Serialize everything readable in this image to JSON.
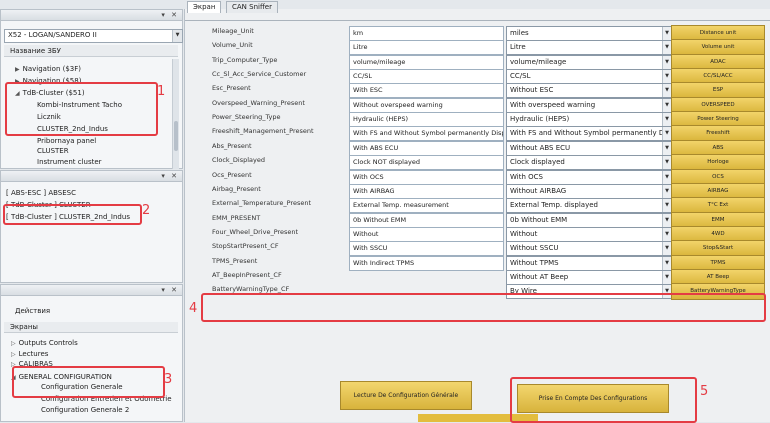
{
  "left_top": {
    "ecu_select": "X52 - LOGAN/SANDERO II",
    "list_header": "Название ЗБУ",
    "tree": [
      {
        "label": "Navigation ($3F)",
        "level": 0,
        "arrow": "▶"
      },
      {
        "label": "Navigation ($58)",
        "level": 0,
        "arrow": "▶"
      },
      {
        "label": "TdB-Cluster ($51)",
        "level": 0,
        "arrow": "◢"
      },
      {
        "label": "Kombi-Instrument Tacho",
        "level": 1,
        "arrow": ""
      },
      {
        "label": "Licznik",
        "level": 1,
        "arrow": ""
      },
      {
        "label": "CLUSTER_2nd_Indus",
        "level": 1,
        "arrow": ""
      },
      {
        "label": "Pribornaya panel",
        "level": 1,
        "arrow": ""
      },
      {
        "label": "CLUSTER",
        "level": 1,
        "arrow": ""
      },
      {
        "label": "Instrument cluster",
        "level": 1,
        "arrow": ""
      }
    ]
  },
  "left_mid": {
    "items": [
      "[ ABS-ESC ] ABSESC",
      "[ TdB-Cluster ] CLUSTER",
      "[ TdB-Cluster ] CLUSTER_2nd_Indus"
    ]
  },
  "left_bottom": {
    "title": "Действия",
    "header": "Экраны",
    "items": [
      {
        "label": "Outputs Controls",
        "level": 0,
        "arrow": "▷"
      },
      {
        "label": "Lectures",
        "level": 0,
        "arrow": "▷"
      },
      {
        "label": "CALIBRAS",
        "level": 0,
        "arrow": "▷"
      },
      {
        "label": "GENERAL CONFIGURATION",
        "level": 0,
        "arrow": "◢"
      },
      {
        "label": "Configuration Generale",
        "level": 1,
        "arrow": ""
      },
      {
        "label": "Configuration Entretien et Odometrie",
        "level": 1,
        "arrow": ""
      },
      {
        "label": "Configuration Generale 2",
        "level": 1,
        "arrow": ""
      }
    ]
  },
  "tabs": [
    "Экран",
    "CAN Sniffer"
  ],
  "params": [
    {
      "name": "Mileage_Unit",
      "value": "km",
      "select": "miles",
      "button": "Distance unit"
    },
    {
      "name": "Volume_Unit",
      "value": "Litre",
      "select": "Litre",
      "button": "Volume unit"
    },
    {
      "name": "Trip_Computer_Type",
      "value": "volume/mileage",
      "select": "volume/mileage",
      "button": "ADAC"
    },
    {
      "name": "Cc_Sl_Acc_Service_Customer",
      "value": "CC/SL",
      "select": "CC/SL",
      "button": "CC/SL/ACC"
    },
    {
      "name": "Esc_Present",
      "value": "With ESC",
      "select": "Without ESC",
      "button": "ESP"
    },
    {
      "name": "Overspeed_Warning_Present",
      "value": "Without overspeed warning",
      "select": "With overspeed warning",
      "button": "OVERSPEED"
    },
    {
      "name": "Power_Steering_Type",
      "value": "Hydraulic (HEPS)",
      "select": "Hydraulic (HEPS)",
      "button": "Power Steering"
    },
    {
      "name": "Freeshift_Management_Present",
      "value": "With FS and Without Symbol permanently Disp",
      "select": "With FS and Without Symbol permanently Dis",
      "button": "Freeshift"
    },
    {
      "name": "Abs_Present",
      "value": "With ABS ECU",
      "select": "Without ABS ECU",
      "button": "ABS"
    },
    {
      "name": "Clock_Displayed",
      "value": "Clock NOT displayed",
      "select": "Clock displayed",
      "button": "Horloge"
    },
    {
      "name": "Ocs_Present",
      "value": "With OCS",
      "select": "With OCS",
      "button": "OCS"
    },
    {
      "name": "Airbag_Present",
      "value": "With AIRBAG",
      "select": "Without AIRBAG",
      "button": "AIRBAG"
    },
    {
      "name": "External_Temperature_Present",
      "value": "External Temp. measurement",
      "select": "External Temp. displayed",
      "button": "T°C Ext"
    },
    {
      "name": "EMM_PRESENT",
      "value": "0b Without EMM",
      "select": "0b Without EMM",
      "button": "EMM"
    },
    {
      "name": "Four_Wheel_Drive_Present",
      "value": "Without",
      "select": "Without",
      "button": "4WD"
    },
    {
      "name": "StopStartPresent_CF",
      "value": "With SSCU",
      "select": "Without SSCU",
      "button": "Stop&Start"
    },
    {
      "name": "TPMS_Present",
      "value": "With Indirect TPMS",
      "select": "Without TPMS",
      "button": "TPMS"
    },
    {
      "name": "AT_BeepInPresent_CF",
      "value": "",
      "select": "Without AT Beep",
      "button": "AT Beep"
    },
    {
      "name": "BatteryWarningType_CF",
      "value": "",
      "select": "By Wire",
      "button": "BatteryWarningType"
    }
  ],
  "bottom_buttons": {
    "read": "Lecture De Configuration Générale",
    "write": "Prise En Compte Des Configurations"
  },
  "markers": [
    "1",
    "2",
    "3",
    "4",
    "5"
  ],
  "colors": {
    "highlight": "#e43c44",
    "button": "#e6c24e"
  }
}
